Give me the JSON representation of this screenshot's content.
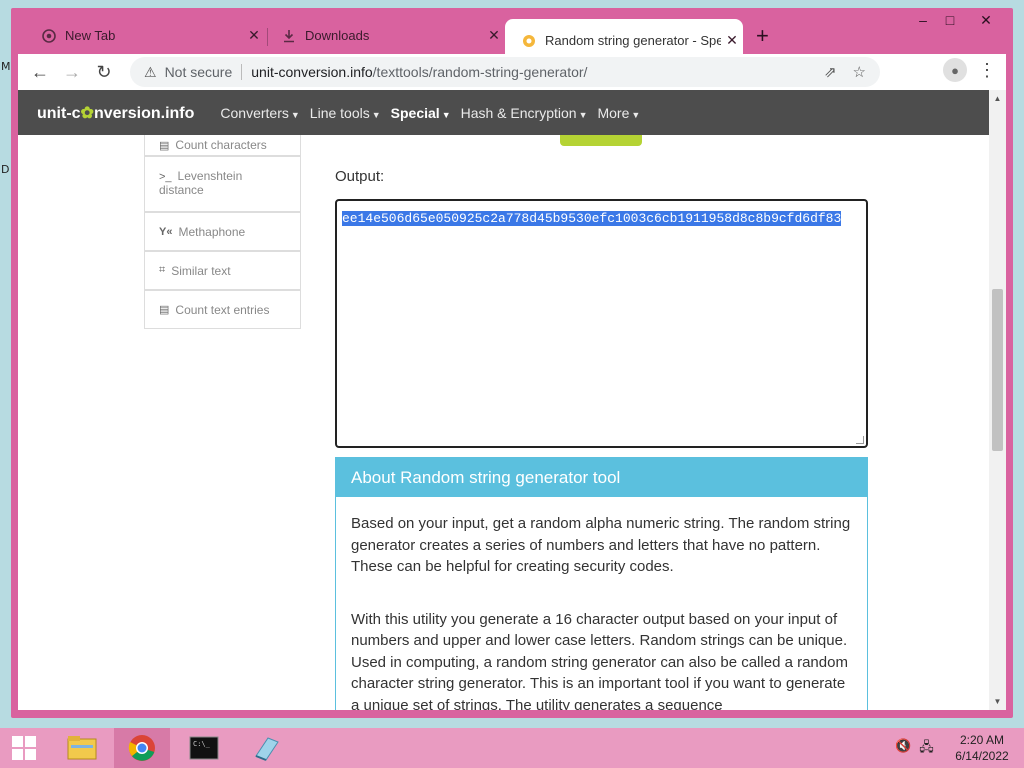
{
  "browser": {
    "tabs": [
      {
        "label": "New Tab",
        "icon": "chrome-icon",
        "active": false
      },
      {
        "label": "Downloads",
        "icon": "download-icon",
        "active": false
      },
      {
        "label": "Random string generator - Speci",
        "icon": "site-favicon",
        "active": true
      }
    ],
    "new_tab_symbol": "+",
    "window_controls": {
      "minimize": "–",
      "maximize": "□",
      "close": "✕"
    },
    "nav": {
      "back": "←",
      "forward": "→",
      "reload": "↻"
    },
    "address": {
      "security_label": "Not secure",
      "host": "unit-conversion.info",
      "path": "/texttools/random-string-generator/"
    }
  },
  "site": {
    "logo_prefix": "unit-c",
    "logo_gear": "✿",
    "logo_suffix": "nversion.info",
    "menu": [
      {
        "label": "Converters",
        "bold": false
      },
      {
        "label": "Line tools",
        "bold": false
      },
      {
        "label": "Special",
        "bold": true
      },
      {
        "label": "Hash & Encryption",
        "bold": false
      },
      {
        "label": "More",
        "bold": false
      }
    ],
    "sidebar": {
      "partial_item": "Count characters",
      "levenshtein_line1": "Levenshtein",
      "levenshtein_line2": "distance",
      "methaphone": "Methaphone",
      "similar_text": "Similar text",
      "count_entries": "Count text entries"
    },
    "output_label": "Output:",
    "output_value": "ee14e506d65e050925c2a778d45b9530efc1003c6cb1911958d8c8b9cfd6df83",
    "about": {
      "title": "About Random string generator tool",
      "paragraph1": "Based on your input, get a random alpha numeric string. The random string generator creates a series of numbers and letters that have no pattern. These can be helpful for creating security codes.",
      "paragraph2": "With this utility you generate a 16 character output based on your input of numbers and upper and lower case letters.  Random strings can be unique. Used in computing, a random string generator can also be called a random character string generator. This is an important tool if you want to generate a unique set of strings. The utility generates a sequence"
    }
  },
  "taskbar": {
    "time": "2:20 AM",
    "date": "6/14/2022"
  },
  "colors": {
    "window_frame": "#d9629f",
    "site_nav": "#4d4d4d",
    "accent_green": "#b5d334",
    "about_blue": "#5bc0de",
    "selection": "#3b78e7"
  }
}
